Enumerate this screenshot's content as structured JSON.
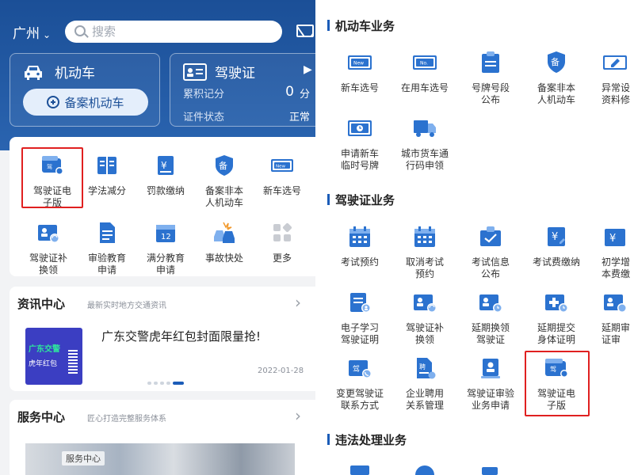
{
  "left": {
    "header": {
      "city": "广州",
      "search_placeholder": "搜索"
    },
    "vehicle_card": {
      "title": "机动车",
      "record_button": "备案机动车"
    },
    "license_card": {
      "title": "驾驶证",
      "points_label": "累积记分",
      "points_value": "0",
      "points_unit": "分",
      "status_label": "证件状态",
      "status_value": "正常"
    },
    "grid": [
      {
        "line1": "驾驶证电",
        "line2": "子版",
        "icon": "e-license-icon",
        "highlighted": true
      },
      {
        "line1": "学法减分",
        "line2": "",
        "icon": "book-icon"
      },
      {
        "line1": "罚款缴纳",
        "line2": "",
        "icon": "fine-payment-icon"
      },
      {
        "line1": "备案非本",
        "line2": "人机动车",
        "icon": "shield-record-icon"
      },
      {
        "line1": "新车选号",
        "line2": "",
        "icon": "new-plate-icon"
      },
      {
        "line1": "驾驶证补",
        "line2": "换领",
        "icon": "license-renew-icon"
      },
      {
        "line1": "审验教育",
        "line2": "申请",
        "icon": "document-icon"
      },
      {
        "line1": "满分教育",
        "line2": "申请",
        "icon": "calendar-12-icon"
      },
      {
        "line1": "事故快处",
        "line2": "",
        "icon": "accident-icon"
      },
      {
        "line1": "更多",
        "line2": "",
        "icon": "more-grid-icon"
      }
    ],
    "news": {
      "title": "资讯中心",
      "subtitle": "最新实时地方交通资讯",
      "headline": "广东交警虎年红包封面限量抢!",
      "date": "2022-01-28",
      "thumb_line1": "广东交警",
      "thumb_line2": "虎年红包"
    },
    "service": {
      "title": "服务中心",
      "subtitle": "匠心打造完整服务体系",
      "image_tag": "服务中心"
    }
  },
  "right": {
    "sections": [
      {
        "title": "机动车业务",
        "items": [
          {
            "line1": "新车选号",
            "line2": "",
            "icon": "new-plate-icon"
          },
          {
            "line1": "在用车选号",
            "line2": "",
            "icon": "plate-no-icon"
          },
          {
            "line1": "号牌号段",
            "line2": "公布",
            "icon": "plate-range-icon"
          },
          {
            "line1": "备案非本",
            "line2": "人机动车",
            "icon": "shield-record-icon"
          },
          {
            "line1": "异常设",
            "line2": "资料修",
            "icon": "edit-card-icon"
          },
          {
            "line1": "申请新车",
            "line2": "临时号牌",
            "icon": "temp-plate-icon"
          },
          {
            "line1": "城市货车通",
            "line2": "行码申领",
            "icon": "truck-icon"
          }
        ]
      },
      {
        "title": "驾驶证业务",
        "items": [
          {
            "line1": "考试预约",
            "line2": "",
            "icon": "calendar-icon"
          },
          {
            "line1": "取消考试",
            "line2": "预约",
            "icon": "calendar-cancel-icon"
          },
          {
            "line1": "考试信息",
            "line2": "公布",
            "icon": "exam-info-icon"
          },
          {
            "line1": "考试费缴纳",
            "line2": "",
            "icon": "fee-payment-icon"
          },
          {
            "line1": "初学增",
            "line2": "本费缴",
            "icon": "yen-card-icon"
          },
          {
            "line1": "电子学习",
            "line2": "驾驶证明",
            "icon": "study-cert-icon"
          },
          {
            "line1": "驾驶证补",
            "line2": "换领",
            "icon": "license-renew-icon"
          },
          {
            "line1": "延期换领",
            "line2": "驾驶证",
            "icon": "license-extend-icon"
          },
          {
            "line1": "延期提交",
            "line2": "身体证明",
            "icon": "health-cert-icon"
          },
          {
            "line1": "延期审",
            "line2": "证审",
            "icon": "license-extend-icon"
          },
          {
            "line1": "变更驾驶证",
            "line2": "联系方式",
            "icon": "contact-change-icon"
          },
          {
            "line1": "企业聘用",
            "line2": "关系管理",
            "icon": "employment-icon"
          },
          {
            "line1": "驾驶证审验",
            "line2": "业务申请",
            "icon": "stamp-icon"
          },
          {
            "line1": "驾驶证电",
            "line2": "子版",
            "icon": "e-license-icon",
            "highlighted": true
          }
        ]
      },
      {
        "title": "违法处理业务",
        "items": []
      }
    ]
  }
}
